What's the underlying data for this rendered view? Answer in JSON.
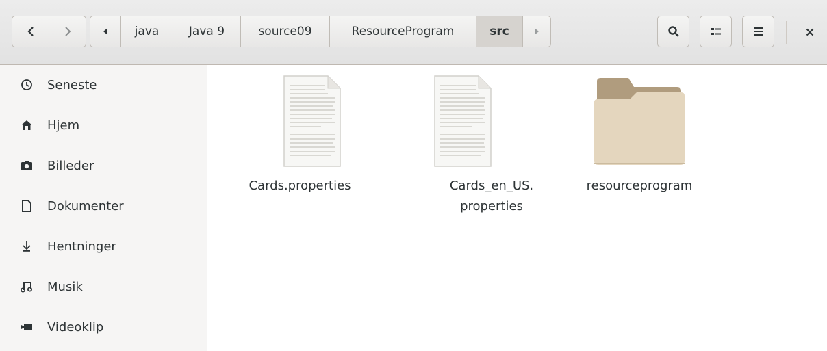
{
  "nav": {
    "back_icon": "chevron-left-icon",
    "forward_icon": "chevron-right-icon"
  },
  "breadcrumbs": [
    "java",
    "Java 9",
    "source09",
    "ResourceProgram",
    "src"
  ],
  "sidebar": {
    "items": [
      {
        "label": "Seneste",
        "icon": "clock-icon"
      },
      {
        "label": "Hjem",
        "icon": "home-icon"
      },
      {
        "label": "Billeder",
        "icon": "camera-icon"
      },
      {
        "label": "Dokumenter",
        "icon": "document-icon"
      },
      {
        "label": "Hentninger",
        "icon": "download-icon"
      },
      {
        "label": "Musik",
        "icon": "music-icon"
      },
      {
        "label": "Videoklip",
        "icon": "video-icon"
      }
    ]
  },
  "files": [
    {
      "line1": "Cards.properties",
      "line2": "",
      "type": "text-file"
    },
    {
      "line1": "Cards_en_US.",
      "line2": "properties",
      "type": "text-file"
    },
    {
      "line1": "resourceprogram",
      "line2": "",
      "type": "folder"
    }
  ],
  "colors": {
    "folder_front": "#e4d6be",
    "folder_back": "#b09c7e",
    "crumb_active": "#d6d3cf"
  }
}
